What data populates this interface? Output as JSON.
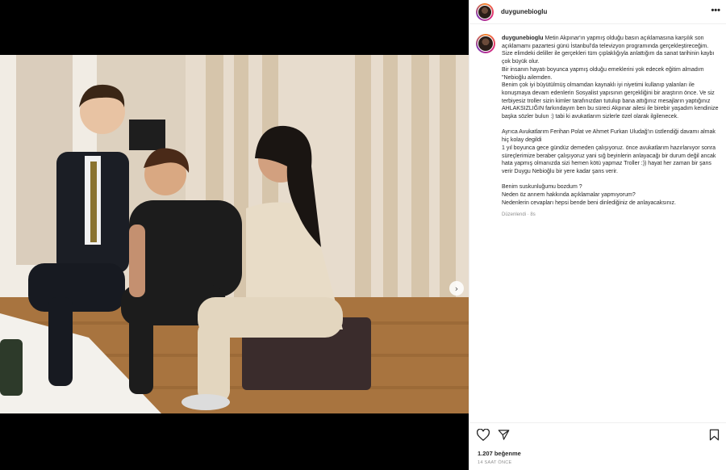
{
  "post": {
    "username": "duygunebioglu",
    "more_label": "•••"
  },
  "caption": {
    "lines": [
      "Metin Akpınar'ın yapmış olduğu basın açıklamasına karşılık son açıklamamı pazartesi günü İstanbul'da televizyon programında gerçekleştireceğim.",
      "Size elimdeki deliller ile gerçekleri tüm çıplaklığıyla anlattığım da sanat tarihinin kaybı çok büyük olur.",
      "Bir insanın hayatı boyunca yapmış olduğu emeklerini yok edecek eğitim almadım \"Nebioğlu ailemden.",
      "Benim çok iyi büyütülmüş olmamdan kaynaklı iyi niyetimi kullanıp yalanları ile konuşmaya devam edenlerin Sosyalist yapısının gerçekliğini bir araştırın önce. Ve siz terbiyesiz troller sizin kimler tarafınızdan tutulup bana attığınız mesajların yaptığınız AHLAKSIZLIĞIN farkındayım ben bu süreci Akpınar ailesi ile birebir yaşadım kendinize başka sözler bulun :) tabi ki avukatlarım sizlerle özel olarak ilgilenecek.",
      "",
      "Ayrıca Avukatlarım Ferihan Polat ve Ahmet Furkan Uludağ'ın üstlendiği davamı almak hiç kolay degildi",
      "1 yıl boyunca gece gündüz demeden çalışıyoruz. önce avukatlarım hazırlanıyor sonra süreçlerimize beraber çalışıyoruz yani sığ beyinlerin anlayacağı bir durum değil ancak hata yapmış olmanızda sizi hemen kötü yapmaz Troller :)) hayat her zaman bir şans verir Duygu Nebioğlu bir yere kadar şans verir.",
      "",
      "Benim suskunluğumu bozdum ?",
      "Neden öz annem hakkında açıklamalar yapmıyorum?",
      "Nedenlerin cevapları hepsi bende beni dinlediğiniz de anlayacaksınız."
    ],
    "edited_label": "Düzenlendi · 8s"
  },
  "actions": {
    "like_icon": "heart-icon",
    "share_icon": "send-icon",
    "save_icon": "bookmark-icon"
  },
  "stats": {
    "likes_label": "1.207 beğenme",
    "time_label": "14 SAAT ÖNCE"
  },
  "carousel": {
    "next_icon": "chevron-right-icon",
    "slides": 3,
    "active_index": 0
  },
  "colors": {
    "accent": "#3897f0",
    "text": "#262626",
    "muted": "#8e8e8e"
  }
}
